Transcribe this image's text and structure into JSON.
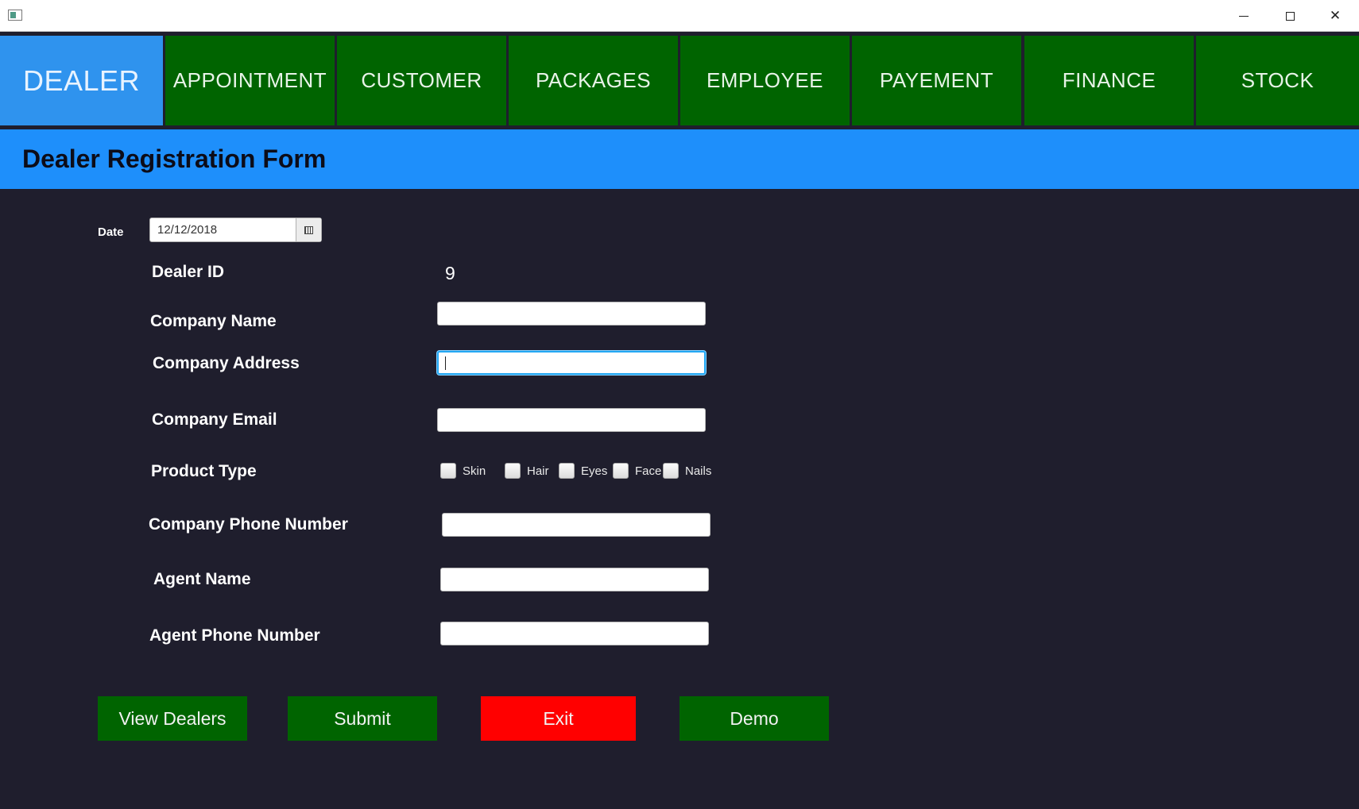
{
  "window": {
    "minimize": "–",
    "maximize": "□",
    "close": "✕"
  },
  "tabs": [
    {
      "label": "DEALER",
      "active": true
    },
    {
      "label": "APPOINTMENT",
      "active": false
    },
    {
      "label": "CUSTOMER",
      "active": false
    },
    {
      "label": "PACKAGES",
      "active": false
    },
    {
      "label": "EMPLOYEE",
      "active": false
    },
    {
      "label": "PAYEMENT",
      "active": false
    },
    {
      "label": "FINANCE",
      "active": false
    },
    {
      "label": "STOCK",
      "active": false
    }
  ],
  "header": {
    "title": "Dealer Registration Form"
  },
  "form": {
    "date": {
      "label": "Date",
      "value": "12/12/2018"
    },
    "dealer_id": {
      "label": "Dealer ID",
      "value": "9"
    },
    "company_name": {
      "label": "Company Name",
      "value": ""
    },
    "company_address": {
      "label": "Company Address",
      "value": ""
    },
    "company_email": {
      "label": "Company Email",
      "value": ""
    },
    "product_type": {
      "label": "Product Type",
      "options": [
        "Skin",
        "Hair",
        "Eyes",
        "Face",
        "Nails"
      ]
    },
    "company_phone": {
      "label": "Company Phone Number",
      "value": ""
    },
    "agent_name": {
      "label": "Agent Name",
      "value": ""
    },
    "agent_phone": {
      "label": "Agent Phone Number",
      "value": ""
    }
  },
  "buttons": {
    "view_dealers": "View Dealers",
    "submit": "Submit",
    "exit": "Exit",
    "demo": "Demo"
  },
  "colors": {
    "tab_green": "#006400",
    "tab_active": "#2f93ee",
    "header_band": "#1e8ffb",
    "background": "#1f1e2d",
    "exit_red": "#ff0000"
  }
}
